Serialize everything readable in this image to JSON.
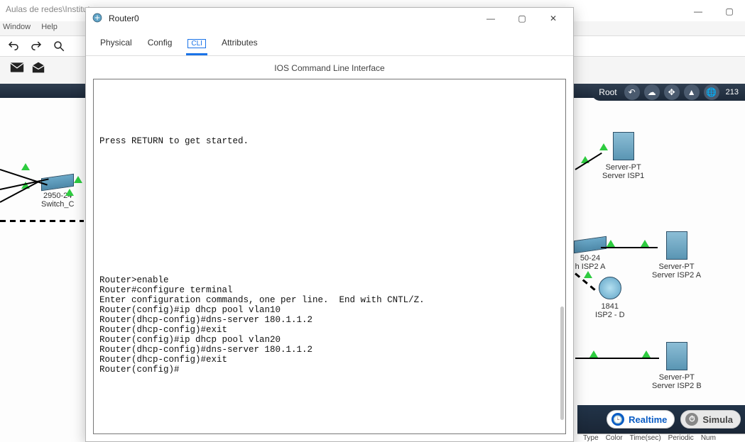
{
  "bg": {
    "titlebar_text": "Aulas de redes\\Institut",
    "menu": {
      "window": "Window",
      "help": "Help"
    },
    "right_strip": {
      "root": "Root",
      "globe_num": "213"
    },
    "mode": {
      "realtime": "Realtime",
      "simulation": "Simula"
    },
    "table_headers": [
      "Type",
      "Color",
      "Time(sec)",
      "Periodic",
      "Num"
    ]
  },
  "devices": {
    "switch_c": {
      "line1": "2950-24",
      "line2": "Switch_C"
    },
    "server_isp1": {
      "line1": "Server-PT",
      "line2": "Server ISP1"
    },
    "switch_isp2a": {
      "line1": "50-24",
      "line2": "h ISP2 A"
    },
    "server_isp2a": {
      "line1": "Server-PT",
      "line2": "Server ISP2 A"
    },
    "router_isp2d": {
      "line1": "1841",
      "line2": "ISP2 - D"
    },
    "server_isp2b": {
      "line1": "Server-PT",
      "line2": "Server ISP2 B"
    }
  },
  "router_window": {
    "title": "Router0",
    "tabs": {
      "physical": "Physical",
      "config": "Config",
      "cli": "CLI",
      "attributes": "Attributes"
    },
    "panel_title": "IOS Command Line Interface",
    "terminal": "\n\n\n\n\nPress RETURN to get started.\n\n\n\n\n\n\n\n\n\n\n\n\n\nRouter>enable\nRouter#configure terminal\nEnter configuration commands, one per line.  End with CNTL/Z.\nRouter(config)#ip dhcp pool vlan10\nRouter(dhcp-config)#dns-server 180.1.1.2\nRouter(dhcp-config)#exit\nRouter(config)#ip dhcp pool vlan20\nRouter(dhcp-config)#dns-server 180.1.1.2\nRouter(dhcp-config)#exit\nRouter(config)#"
  }
}
